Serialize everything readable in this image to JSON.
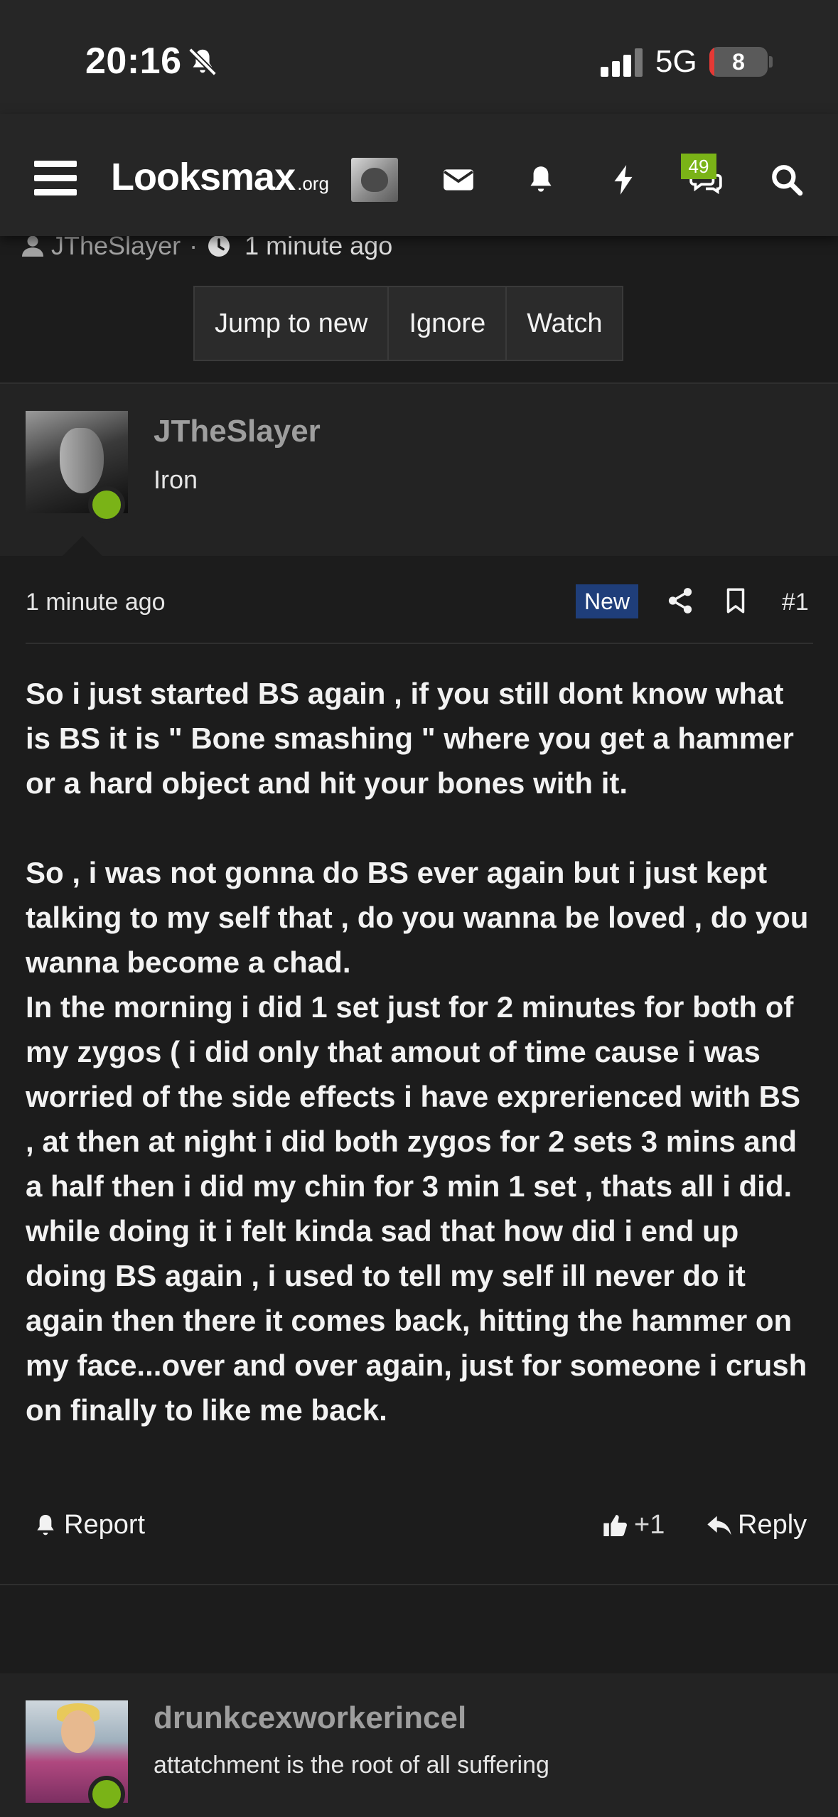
{
  "status_bar": {
    "time": "20:16",
    "network": "5G",
    "battery_percent": "8",
    "battery_level": 0.08,
    "signal_bars_active": 3,
    "icons": [
      "bell-slash-icon",
      "signal-icon",
      "battery-icon"
    ]
  },
  "nav": {
    "logo_main": "Looksmax",
    "logo_suffix": ".org",
    "notifications_badge": "49",
    "icons": [
      "menu-icon",
      "envelope-icon",
      "bell-icon",
      "bolt-icon",
      "comments-icon",
      "search-icon"
    ]
  },
  "thread": {
    "starter": "JTheSlayer",
    "separator": "·",
    "time_ago": "1 minute ago",
    "buttons": [
      "Jump to new",
      "Ignore",
      "Watch"
    ]
  },
  "post": {
    "author": "JTheSlayer",
    "author_title": "Iron",
    "time": "1 minute ago",
    "badge": "New",
    "number": "#1",
    "body": [
      "So i just started BS again , if you still dont know what is BS it is \" Bone smashing \" where you get a hammer or a hard object and hit your bones with it.",
      "",
      "So , i was not gonna do BS ever again but i just kept talking to my self that , do you wanna be loved , do you wanna become a chad.",
      "In the morning i did 1 set just for 2 minutes for both of my zygos ( i did only that amout of time cause i was worried of the side effects i have exprerienced with BS , at then at night i did both zygos for 2 sets 3 mins and a half then i did my chin for 3 min 1 set , thats all i did.",
      "while doing it i felt kinda sad that how did i end up doing BS again , i used to tell my self ill never do it again then there it comes back, hitting the hammer on my face...over and over again, just for someone i crush on finally to like me back."
    ],
    "actions": {
      "report": "Report",
      "like_count": "+1",
      "reply": "Reply"
    }
  },
  "next_post": {
    "author": "drunkcexworkerincel",
    "author_title": "attatchment is the root of all suffering"
  },
  "colors": {
    "online": "#7ab317",
    "new_badge": "#1f3e7a",
    "battery_low": "#e53935",
    "background": "#1c1c1c",
    "header_bg": "#262626"
  }
}
